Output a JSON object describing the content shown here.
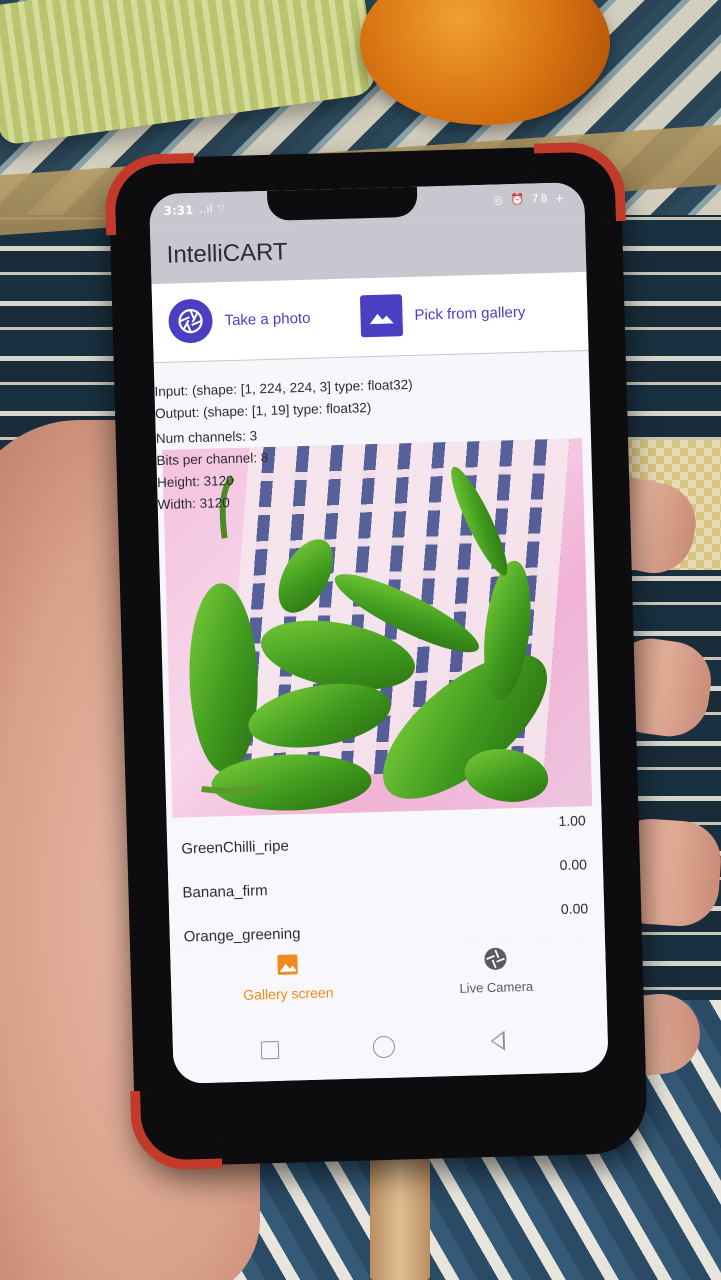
{
  "status_bar": {
    "time": "3:31",
    "signal_icons": "..ıl ⌔",
    "right_icons": "◎ ⏰ 78 +"
  },
  "app": {
    "title": "IntelliCART"
  },
  "actions": {
    "take_photo_label": "Take a photo",
    "pick_gallery_label": "Pick from gallery"
  },
  "model_info": {
    "input": "Input: (shape: [1, 224, 224, 3] type: float32)",
    "output": "Output: (shape: [1, 19] type: float32)"
  },
  "image_info": {
    "num_channels": "Num channels: 3",
    "bits_per_channel": "Bits per channel: 8",
    "height": "Height: 3120",
    "width": "Width: 3120"
  },
  "results": [
    {
      "label": "GreenChilli_ripe",
      "score": "1.00"
    },
    {
      "label": "Banana_firm",
      "score": "0.00"
    },
    {
      "label": "Orange_greening",
      "score": "0.00"
    }
  ],
  "bottom_nav": {
    "gallery_label": "Gallery screen",
    "live_label": "Live Camera"
  },
  "colors": {
    "accent": "#4a3fc2",
    "active_tab": "#f08a1c",
    "app_bar": "#c8c7d0"
  }
}
